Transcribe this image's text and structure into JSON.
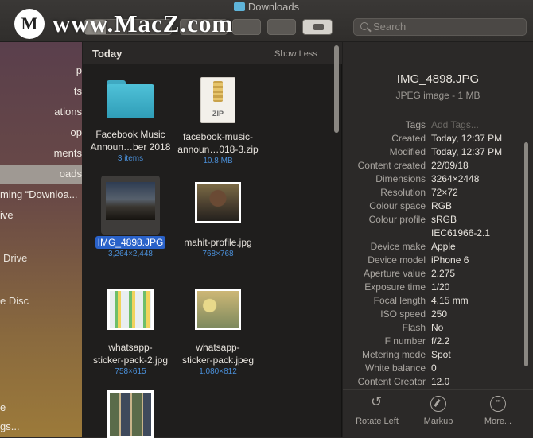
{
  "window": {
    "title": "Downloads"
  },
  "watermark": {
    "text": "www.MacZ.com"
  },
  "search": {
    "placeholder": "Search"
  },
  "sidebar": {
    "items": [
      {
        "label": "p"
      },
      {
        "label": "ts"
      },
      {
        "label": "ations"
      },
      {
        "label": "op"
      },
      {
        "label": "ments"
      },
      {
        "label": "oads"
      },
      {
        "label": "ming “Downloa..."
      },
      {
        "label": "ive"
      },
      {
        "label": "Drive"
      },
      {
        "label": "e Disc"
      },
      {
        "label": "e"
      },
      {
        "label": "gs..."
      }
    ],
    "selected_index": 5
  },
  "files": {
    "section_title": "Today",
    "show_less": "Show Less",
    "items": [
      {
        "name_line1": "Facebook Music",
        "name_line2": "Announ…ber 2018",
        "sub": "3 items",
        "kind": "folder"
      },
      {
        "name_line1": "facebook-music-",
        "name_line2": "announ…018-3.zip",
        "sub": "10.8 MB",
        "kind": "zip"
      },
      {
        "name_line1": "IMG_4898.JPG",
        "name_line2": "",
        "sub": "3,264×2,448",
        "kind": "photo-dark",
        "selected": true
      },
      {
        "name_line1": "mahit-profile.jpg",
        "name_line2": "",
        "sub": "768×768",
        "kind": "photo-portrait"
      },
      {
        "name_line1": "whatsapp-",
        "name_line2": "sticker-pack-2.jpg",
        "sub": "758×615",
        "kind": "photo-stickers"
      },
      {
        "name_line1": "whatsapp-",
        "name_line2": "sticker-pack.jpeg",
        "sub": "1,080×812",
        "kind": "photo-sticker2"
      },
      {
        "name_line1": "",
        "name_line2": "",
        "sub": "",
        "kind": "photo-grid"
      }
    ],
    "zip_label": "ZIP"
  },
  "inspector": {
    "title": "IMG_4898.JPG",
    "subtitle": "JPEG image - 1 MB",
    "rows": [
      {
        "k": "Tags",
        "v": "Add Tags..."
      },
      {
        "k": "Created",
        "v": "Today, 12:37 PM"
      },
      {
        "k": "Modified",
        "v": "Today, 12:37 PM"
      },
      {
        "k": "Content created",
        "v": "22/09/18"
      },
      {
        "k": "Dimensions",
        "v": "3264×2448"
      },
      {
        "k": "Resolution",
        "v": "72×72"
      },
      {
        "k": "Colour space",
        "v": "RGB"
      },
      {
        "k": "Colour profile",
        "v": "sRGB"
      },
      {
        "k": "",
        "v": "IEC61966-2.1"
      },
      {
        "k": "Device make",
        "v": "Apple"
      },
      {
        "k": "Device model",
        "v": "iPhone 6"
      },
      {
        "k": "Aperture value",
        "v": "2.275"
      },
      {
        "k": "Exposure time",
        "v": "1/20"
      },
      {
        "k": "Focal length",
        "v": "4.15 mm"
      },
      {
        "k": "ISO speed",
        "v": "250"
      },
      {
        "k": "Flash",
        "v": "No"
      },
      {
        "k": "F number",
        "v": "f/2.2"
      },
      {
        "k": "Metering mode",
        "v": "Spot"
      },
      {
        "k": "White balance",
        "v": "0"
      },
      {
        "k": "Content Creator",
        "v": "12.0"
      }
    ],
    "actions": [
      {
        "label": "Rotate Left",
        "icon": "rotate-left-icon"
      },
      {
        "label": "Markup",
        "icon": "markup-icon"
      },
      {
        "label": "More...",
        "icon": "more-icon"
      }
    ]
  }
}
